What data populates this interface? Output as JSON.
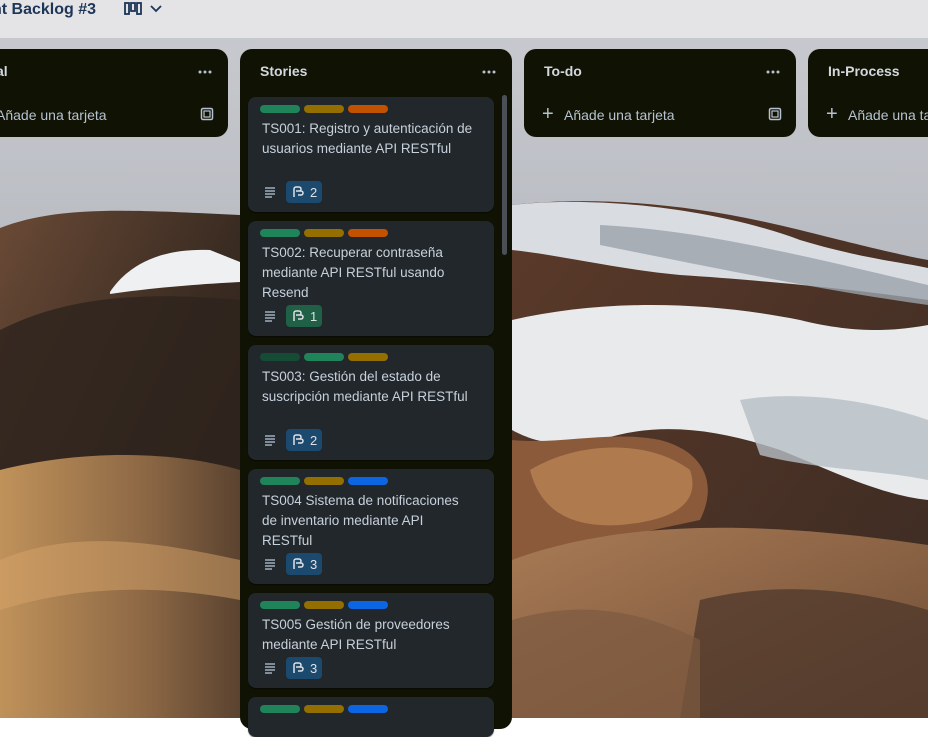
{
  "board": {
    "title": "nt Backlog #3"
  },
  "lists": [
    {
      "title": "al",
      "add_label": "Añade una tarjeta"
    },
    {
      "title": "Stories"
    },
    {
      "title": "To-do",
      "add_label": "Añade una tarjeta"
    },
    {
      "title": "In-Process",
      "add_label": "Añade una ta"
    }
  ],
  "stories": {
    "cards": [
      {
        "title": "TS001: Registro y autenticación de usuarios mediante API RESTful",
        "checklist": "2",
        "labels": [
          "#1f845a",
          "#946f00",
          "#c25100"
        ]
      },
      {
        "title": "TS002: Recuperar contraseña mediante API RESTful usando Resend",
        "checklist": "1",
        "labels": [
          "#1f845a",
          "#946f00",
          "#c25100"
        ]
      },
      {
        "title": "TS003: Gestión del estado de suscripción mediante API RESTful",
        "checklist": "2",
        "labels": [
          "#164b35",
          "#1f845a",
          "#946f00"
        ]
      },
      {
        "title": "TS004 Sistema de notificaciones de inventario mediante API RESTful",
        "checklist": "3",
        "labels": [
          "#1f845a",
          "#946f00",
          "#0c66e4"
        ]
      },
      {
        "title": "TS005 Gestión de proveedores mediante API RESTful",
        "checklist": "3",
        "labels": [
          "#1f845a",
          "#946f00",
          "#0c66e4"
        ]
      }
    ],
    "partial_labels": [
      "#1f845a",
      "#946f00",
      "#0c66e4"
    ]
  },
  "icons": {
    "menu": "ellipsis-icon",
    "add": "plus-icon",
    "template": "card-template-icon",
    "description": "description-icon",
    "checklist": "checklist-icon",
    "view": "board-view-icon",
    "chevron": "chevron-down-icon"
  }
}
